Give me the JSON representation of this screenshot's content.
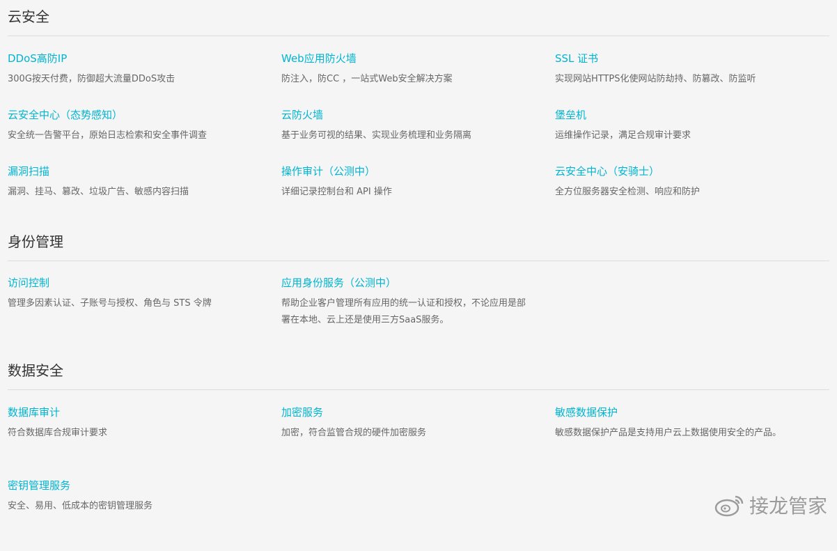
{
  "sections": [
    {
      "title": "云安全",
      "items": [
        {
          "title": "DDoS高防IP",
          "desc": "300G按天付费，防御超大流量DDoS攻击"
        },
        {
          "title": "Web应用防火墙",
          "desc": "防注入，防CC ，一站式Web安全解决方案"
        },
        {
          "title": "SSL 证书",
          "desc": "实现网站HTTPS化使网站防劫持、防篡改、防监听"
        },
        {
          "title": "云安全中心（态势感知）",
          "desc": "安全统一告警平台，原始日志检索和安全事件调查"
        },
        {
          "title": "云防火墙",
          "desc": "基于业务可视的结果、实现业务梳理和业务隔离"
        },
        {
          "title": "堡垒机",
          "desc": "运维操作记录，满足合规审计要求"
        },
        {
          "title": "漏洞扫描",
          "desc": "漏洞、挂马、篡改、垃圾广告、敏感内容扫描"
        },
        {
          "title": "操作审计（公测中）",
          "desc": "详细记录控制台和 API 操作"
        },
        {
          "title": "云安全中心（安骑士）",
          "desc": "全方位服务器安全检测、响应和防护"
        }
      ]
    },
    {
      "title": "身份管理",
      "items": [
        {
          "title": "访问控制",
          "desc": "管理多因素认证、子账号与授权、角色与 STS 令牌"
        },
        {
          "title": "应用身份服务（公测中）",
          "desc": "帮助企业客户管理所有应用的统一认证和授权，不论应用是部署在本地、云上还是使用三方SaaS服务。"
        }
      ]
    },
    {
      "title": "数据安全",
      "items": [
        {
          "title": "数据库审计",
          "desc": "符合数据库合规审计要求"
        },
        {
          "title": "加密服务",
          "desc": "加密，符合监管合规的硬件加密服务"
        },
        {
          "title": "敏感数据保护",
          "desc": "敏感数据保护产品是支持用户云上数据使用安全的产品。"
        },
        {
          "title": "密钥管理服务",
          "desc": "安全、易用、低成本的密钥管理服务"
        }
      ]
    }
  ],
  "watermark": {
    "text": "接龙管家"
  },
  "colors": {
    "link": "#00b5d1",
    "background": "#f5f5f5",
    "divider": "#dcdcdc"
  }
}
